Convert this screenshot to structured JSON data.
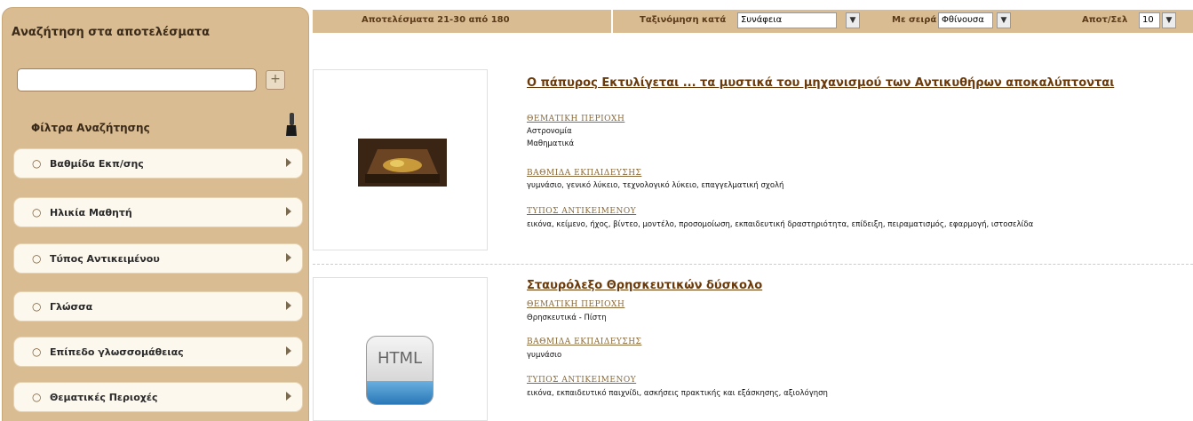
{
  "sidebar": {
    "title": "Αναζήτηση στα αποτελέσματα",
    "search": {
      "value": "",
      "go_icon": "plus-icon"
    },
    "filters_title": "Φίλτρα Αναζήτησης",
    "filters_icon": "brush-icon",
    "filters": [
      {
        "label": "Βαθμίδα Εκπ/σης"
      },
      {
        "label": "Ηλικία Μαθητή"
      },
      {
        "label": "Τύπος Αντικειμένου"
      },
      {
        "label": "Γλώσσα"
      },
      {
        "label": "Επίπεδο γλωσσομάθειας"
      },
      {
        "label": "Θεματικές Περιοχές"
      }
    ]
  },
  "toolbar": {
    "results_text": "Αποτελέσματα 21-30 από 180",
    "sort_label": "Ταξινόμηση κατά",
    "sort_value": "Συνάφεια",
    "order_label": "Με σειρά",
    "order_value": "Φθίνουσα",
    "per_page_label": "Αποτ/Σελ",
    "per_page_value": "10"
  },
  "results": [
    {
      "title": "Ο πάπυρος Εκτυλίγεται ... τα μυστικά του μηχανισμού των Αντικυθήρων αποκαλύπτονται",
      "thumbnail": "antikythera-mechanism-image",
      "sections": [
        {
          "label": "ΘΕΜΑΤΙΚΗ ΠΕΡΙΟΧΗ",
          "value": "Αστρονομία\nΜαθηματικά"
        },
        {
          "label": "ΒΑΘΜΙΔΑ ΕΚΠΑΙΔΕΥΣΗΣ",
          "value": "γυμνάσιο, γενικό λύκειο, τεχνολογικό λύκειο, επαγγελματική σχολή"
        },
        {
          "label": "ΤΥΠΟΣ ΑΝΤΙΚΕΙΜΕΝΟΥ",
          "value": "εικόνα, κείμενο, ήχος, βίντεο, μοντέλο, προσομοίωση, εκπαιδευτική δραστηριότητα, επίδειξη, πειραματισμός, εφαρμογή, ιστοσελίδα"
        }
      ]
    },
    {
      "title": "Σταυρόλεξο Θρησκευτικών δύσκολο",
      "thumbnail": "html-file-icon",
      "thumbnail_text": "HTML",
      "sections": [
        {
          "label": "ΘΕΜΑΤΙΚΗ ΠΕΡΙΟΧΗ",
          "value": "Θρησκευτικά - Πίστη"
        },
        {
          "label": "ΒΑΘΜΙΔΑ ΕΚΠΑΙΔΕΥΣΗΣ",
          "value": "γυμνάσιο"
        },
        {
          "label": "ΤΥΠΟΣ ΑΝΤΙΚΕΙΜΕΝΟΥ",
          "value": "εικόνα, εκπαιδευτικό παιχνίδι, ασκήσεις πρακτικής και εξάσκησης, αξιολόγηση"
        }
      ]
    }
  ]
}
